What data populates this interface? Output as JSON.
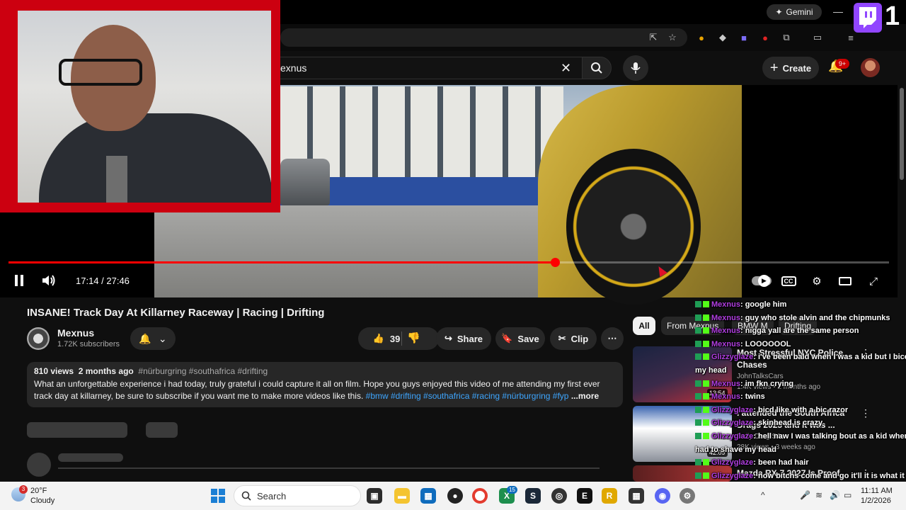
{
  "browser": {
    "gemini_label": "Gemini",
    "minimize": "—"
  },
  "twitch": {
    "badge_number": "1"
  },
  "search": {
    "query": "exnus",
    "clear": "✕"
  },
  "header": {
    "create_label": "Create",
    "notifications_badge": "9+"
  },
  "player": {
    "current_time": "17:14",
    "duration": "27:46",
    "time_display": "17:14 / 27:46",
    "progress_fraction": 0.6206
  },
  "video": {
    "title": "INSANE! Track Day At Killarney Raceway | Racing | Drifting",
    "channel_name": "Mexnus",
    "subscribers": "1.72K subscribers",
    "likes": "39",
    "share_label": "Share",
    "save_label": "Save",
    "clip_label": "Clip",
    "more_label": "⋯"
  },
  "description": {
    "views": "810 views",
    "age": "2 months ago",
    "tags": "#nürburgring #southafrica #drifting",
    "text": "What an unforgettable experience i had today, truly grateful i could capture it all on film. Hope you guys enjoyed this video of me attending my first ever track day at killarney, be sure to subscribe if you want me to make more videos like this.",
    "hashtags": "#bmw #drifting #southafrica #racing #nürburgring #fyp",
    "more_label": "...more"
  },
  "recommendations": {
    "chips": [
      "All",
      "From Mexnus",
      "BMW M",
      "Drifting"
    ],
    "items": [
      {
        "title": "Most Stressful NYC Police",
        "title2": "Chases",
        "channel": "JohnTalksCars",
        "meta": "1.4K views • 2 months ago",
        "duration": "13:54"
      },
      {
        "title": "I attended the South Africa",
        "title2": "Drags 2025 and it was ...",
        "channel": "Daily Drag SA",
        "meta": "28K views • 3 weeks ago",
        "duration": "42:09"
      },
      {
        "title": "Mazda RX-7 2027 Is Proof",
        "title2": "",
        "channel": "",
        "meta": "",
        "duration": ""
      }
    ]
  },
  "chat": [
    {
      "user": "Mexnus",
      "msg": ": google him"
    },
    {
      "user": "Mexnus",
      "msg": ": guy who stole alvin and the chipmunks"
    },
    {
      "user": "Mexnus",
      "msg": ": nigga yall are the same person"
    },
    {
      "user": "Mexnus",
      "msg": ": LOOOOOOL"
    },
    {
      "user": "Glizzyglaze",
      "msg": ": i've been bald when I was a kid but I biced"
    },
    {
      "user": "",
      "msg": "my head"
    },
    {
      "user": "Mexnus",
      "msg": ": im fkn crying"
    },
    {
      "user": "Mexnus",
      "msg": ": twins"
    },
    {
      "user": "Glizzyglaze",
      "msg": ": bicd like with a bic razor"
    },
    {
      "user": "Glizzyglaze",
      "msg": ": skinhead is crazy"
    },
    {
      "user": "Glizzyglaze",
      "msg": ": hell naw I was talking bout as a kid when I"
    },
    {
      "user": "",
      "msg": "had to shave my head"
    },
    {
      "user": "Glizzyglaze",
      "msg": ": been had hair"
    },
    {
      "user": "Glizzyglaze",
      "msg": ": now bitchs come and go it'll it is what it is"
    },
    {
      "user": "",
      "msg": "feel good or not"
    }
  ],
  "taskbar": {
    "weather_badge": "3",
    "temperature": "20°F",
    "weather": "Cloudy",
    "search_label": "Search",
    "time": "11:11 AM",
    "date": "1/2/2026",
    "badge_15": "15"
  },
  "colors": {
    "youtube_red": "#ff0000",
    "webcam_border": "#cc0010",
    "twitch_purple": "#9146ff",
    "link_blue": "#3ea6ff"
  },
  "icons": [
    "search-icon",
    "mic-icon",
    "bell-icon",
    "like-icon",
    "dislike-icon",
    "share-icon",
    "save-icon",
    "clip-icon",
    "pause-icon",
    "volume-icon",
    "captions-icon",
    "settings-icon",
    "theater-icon",
    "fullscreen-icon"
  ]
}
